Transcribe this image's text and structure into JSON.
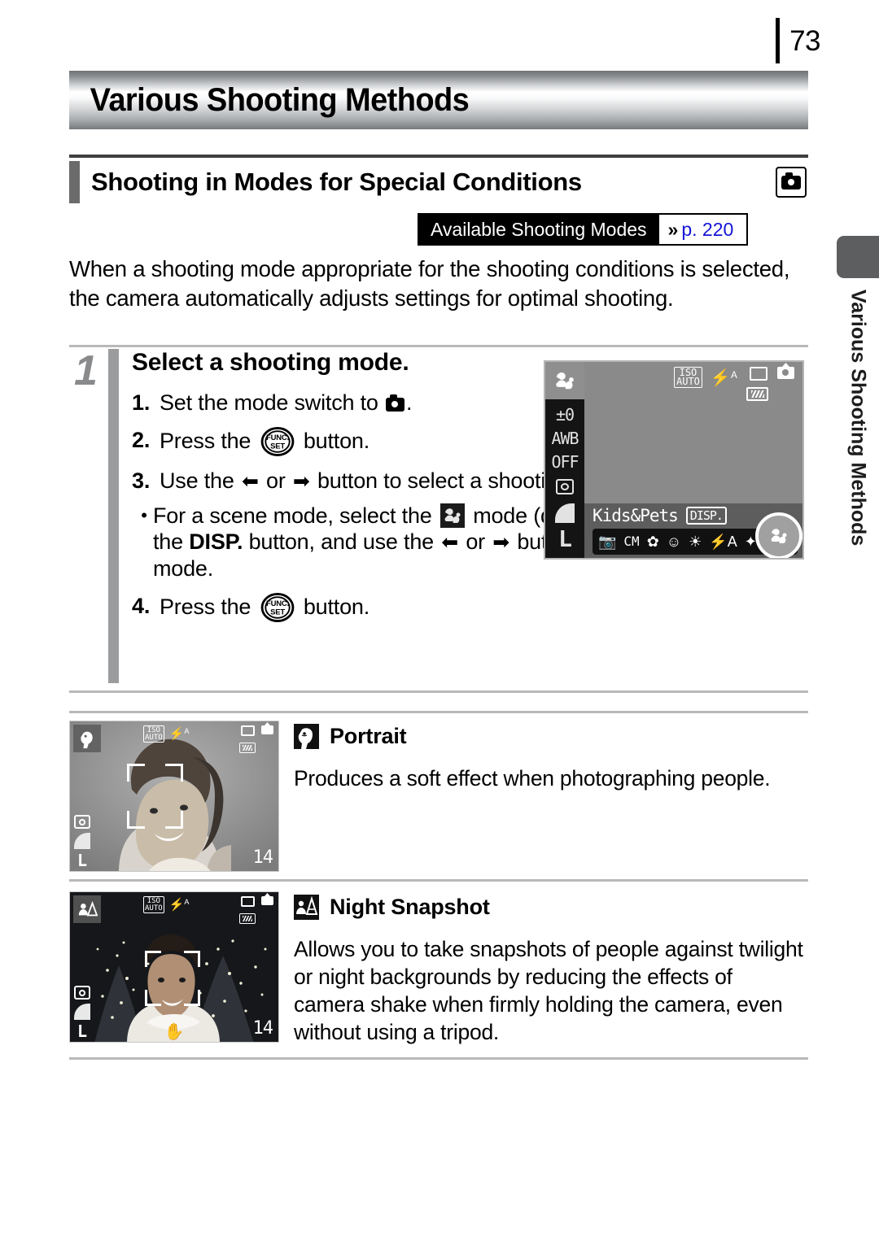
{
  "page": {
    "number": "73",
    "chapter_title": "Various Shooting Methods",
    "side_tab_label": "Various Shooting Methods"
  },
  "section": {
    "title": "Shooting in Modes for Special Conditions",
    "icon": "camera-icon"
  },
  "reference_badge": {
    "label": "Available Shooting Modes",
    "chevron": "»",
    "page_ref": "p. 220",
    "page_ref_color": "#1414d8"
  },
  "intro": {
    "text": "When a shooting mode appropriate for the shooting conditions is selected, the camera automatically adjusts settings for optimal shooting."
  },
  "step": {
    "number": "1",
    "heading": "Select a shooting mode.",
    "items": [
      {
        "marker": "1.",
        "pre": "Set the mode switch to ",
        "icon": "camera-icon",
        "post": "."
      },
      {
        "marker": "2.",
        "pre": "Press the ",
        "icon": "func-set-button",
        "post": " button."
      },
      {
        "marker": "3.",
        "pre": "Use the ",
        "icon": "left-arrow",
        "mid": " or ",
        "icon2": "right-arrow",
        "post": " button to select a shooting mode."
      }
    ],
    "bullet": {
      "marker": "•",
      "part1": "For a scene mode, select the ",
      "icon_scene": "kids-and-pets-icon",
      "part2": " mode (default setting) and press the ",
      "bold": "DISP.",
      "part3": " button, and use the ",
      "icon_left": "left-arrow",
      "part4": " or ",
      "icon_right": "right-arrow",
      "part5": " button to select the desired mode."
    },
    "item4": {
      "marker": "4.",
      "pre": "Press the ",
      "icon": "func-set-button",
      "post": " button."
    }
  },
  "lcd_screen": {
    "sidebar": [
      "±0",
      "AWB",
      "OFF",
      "metering-icon",
      "quality-icon",
      "L"
    ],
    "sidebar_top_icon": "kids-and-pets-icon",
    "iso_label_top": "ISO",
    "iso_label_bottom": "AUTO",
    "flash_label": "A",
    "mode_name": "Kids&Pets",
    "disp_label": "DISP.",
    "mode_bar_icons": [
      "auto-camera-icon",
      "manual-cm-icon",
      "digital-macro-icon",
      "portrait-icon",
      "night-snapshot-icon",
      "indoor-a-icon",
      "kids-and-pets-icon"
    ],
    "selected_mode_icon": "kids-and-pets-icon"
  },
  "modes": [
    {
      "badge_icon": "portrait-icon",
      "title": "Portrait",
      "description": "Produces a soft effect when photographing people.",
      "thumbnail": {
        "scene": "woman-portrait-daylight",
        "iso_top": "ISO",
        "iso_bottom": "AUTO",
        "flash": "A",
        "quality_label": "L",
        "shots_remaining": "14",
        "corner_icon": "portrait-icon"
      }
    },
    {
      "badge_icon": "night-snapshot-icon",
      "title": "Night Snapshot",
      "description": "Allows you to take snapshots of people against twilight or night backgrounds by reducing the effects of camera shake when firmly holding the camera, even without using a tripod.",
      "thumbnail": {
        "scene": "woman-night-christmas-lights",
        "iso_top": "ISO",
        "iso_bottom": "AUTO",
        "flash": "A",
        "quality_label": "L",
        "shots_remaining": "14",
        "corner_icon": "night-snapshot-icon",
        "hand_icon": "camera-shake-warning-icon"
      }
    }
  ]
}
